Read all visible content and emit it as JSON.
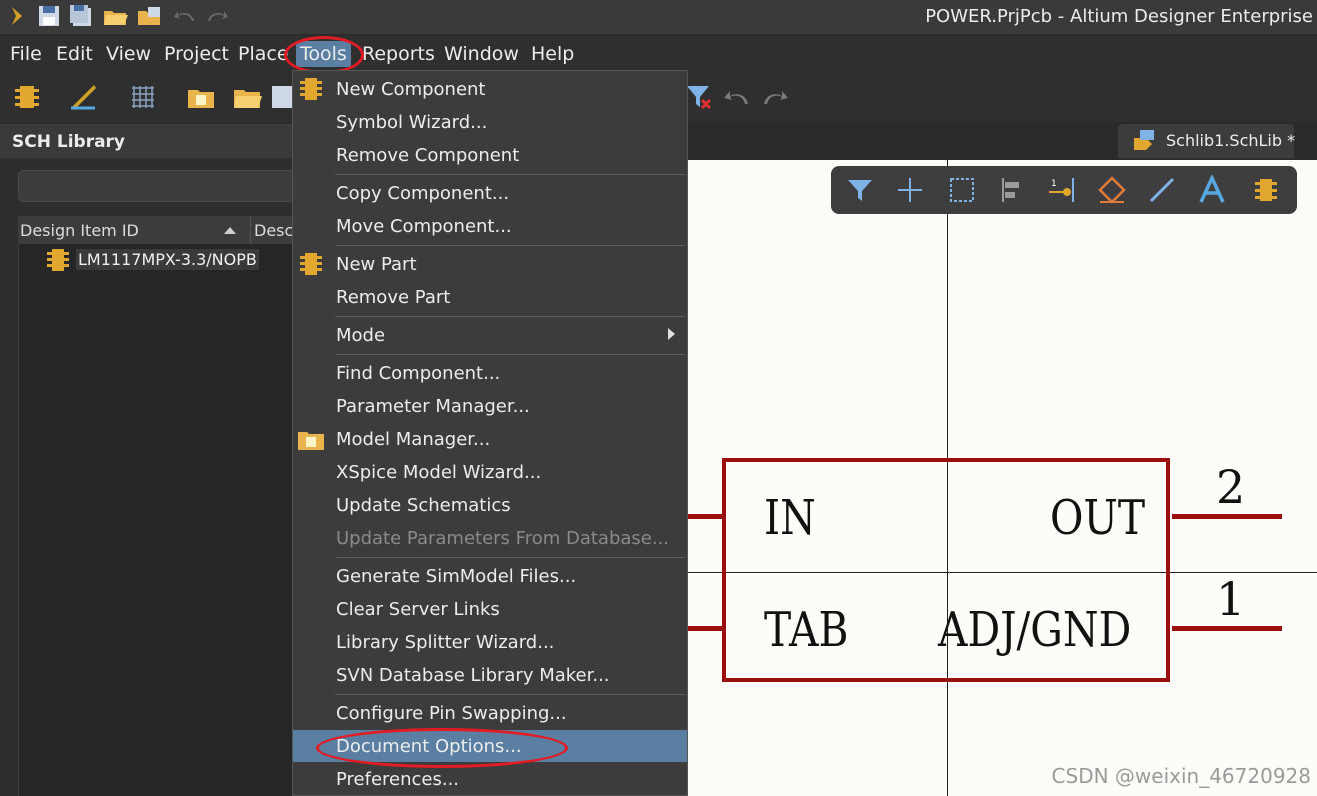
{
  "window": {
    "title": "POWER.PrjPcb - Altium Designer Enterprise"
  },
  "menubar": {
    "items": [
      "File",
      "Edit",
      "View",
      "Project",
      "Place",
      "Tools",
      "Reports",
      "Window",
      "Help"
    ],
    "active": "Tools"
  },
  "panel": {
    "title": "SCH Library",
    "columns": [
      "Design Item ID",
      "Descr"
    ],
    "items": [
      {
        "name": "LM1117MPX-3.3/NOPB"
      }
    ]
  },
  "document_tab": {
    "label": "Schlib1.SchLib *"
  },
  "tools_menu": {
    "items": [
      {
        "label": "New Component",
        "icon": "component-icon"
      },
      {
        "label": "Symbol Wizard..."
      },
      {
        "label": "Remove Component"
      },
      {
        "label": "Copy Component..."
      },
      {
        "label": "Move Component..."
      },
      {
        "label": "New Part",
        "icon": "component-icon"
      },
      {
        "label": "Remove Part"
      },
      {
        "label": "Mode",
        "submenu": true
      },
      {
        "label": "Find Component..."
      },
      {
        "label": "Parameter Manager..."
      },
      {
        "label": "Model Manager...",
        "icon": "folder-chip-icon"
      },
      {
        "label": "XSpice Model Wizard..."
      },
      {
        "label": "Update Schematics"
      },
      {
        "label": "Update Parameters From Database...",
        "disabled": true
      },
      {
        "label": "Generate SimModel Files..."
      },
      {
        "label": "Clear Server Links"
      },
      {
        "label": "Library Splitter Wizard..."
      },
      {
        "label": "SVN Database Library Maker..."
      },
      {
        "label": "Configure Pin Swapping..."
      },
      {
        "label": "Document Options...",
        "selected": true
      },
      {
        "label": "Preferences..."
      }
    ]
  },
  "component": {
    "pins": [
      {
        "name": "IN"
      },
      {
        "name": "OUT",
        "number": "2"
      },
      {
        "name": "TAB"
      },
      {
        "name": "ADJ/GND",
        "number": "1"
      }
    ]
  },
  "watermark": "CSDN @weixin_46720928",
  "colors": {
    "menu_bg": "#3c3c3c",
    "highlight": "#5a7fa3",
    "pin_red": "#9a0e0e",
    "annotation_red": "#e31b23"
  }
}
